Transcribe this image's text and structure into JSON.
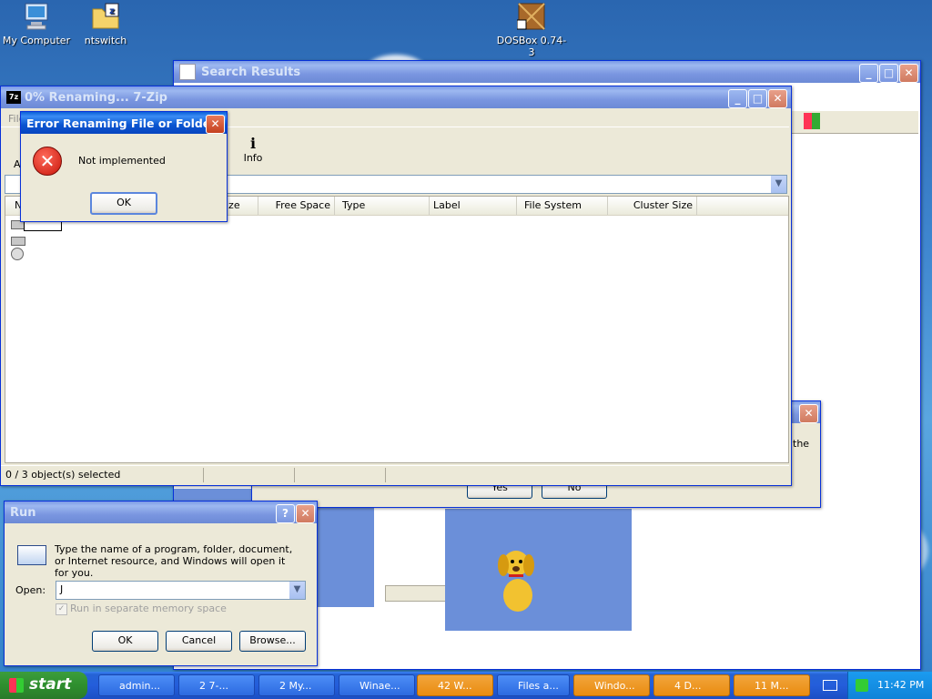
{
  "desktop": {
    "icons": [
      {
        "label": "My Computer"
      },
      {
        "label": "ntswitch"
      },
      {
        "label": "DOSBox 0.74-3"
      }
    ]
  },
  "search_window": {
    "title": "Search Results"
  },
  "zip_window": {
    "title": "0% Renaming... 7-Zip",
    "toolbar_info": "Info",
    "columns": [
      "ize",
      "Free Space",
      "Type",
      "Label",
      "File System",
      "Cluster Size"
    ],
    "status": "0 / 3 object(s) selected",
    "menu_partial": "File",
    "left_partial_a": "A",
    "left_partial_n": "N"
  },
  "error_dialog": {
    "title": "Error Renaming File or Folder",
    "message": "Not implemented",
    "ok": "OK"
  },
  "back_dialog": {
    "text_partial": "the",
    "yes": "Yes",
    "no": "No"
  },
  "run_dialog": {
    "title": "Run",
    "description": "Type the name of a program, folder, document, or Internet resource, and Windows will open it for you.",
    "open_label": "Open:",
    "open_value": "J",
    "checkbox_label": "Run in separate memory space",
    "ok": "OK",
    "cancel": "Cancel",
    "browse": "Browse..."
  },
  "taskbar": {
    "start": "start",
    "buttons": [
      "admin...",
      "2 7-...",
      "2 My...",
      "Winae...",
      "42 W...",
      "Files a...",
      "Windo...",
      "4 D...",
      "11 M..."
    ],
    "clock": "11:42 PM"
  }
}
